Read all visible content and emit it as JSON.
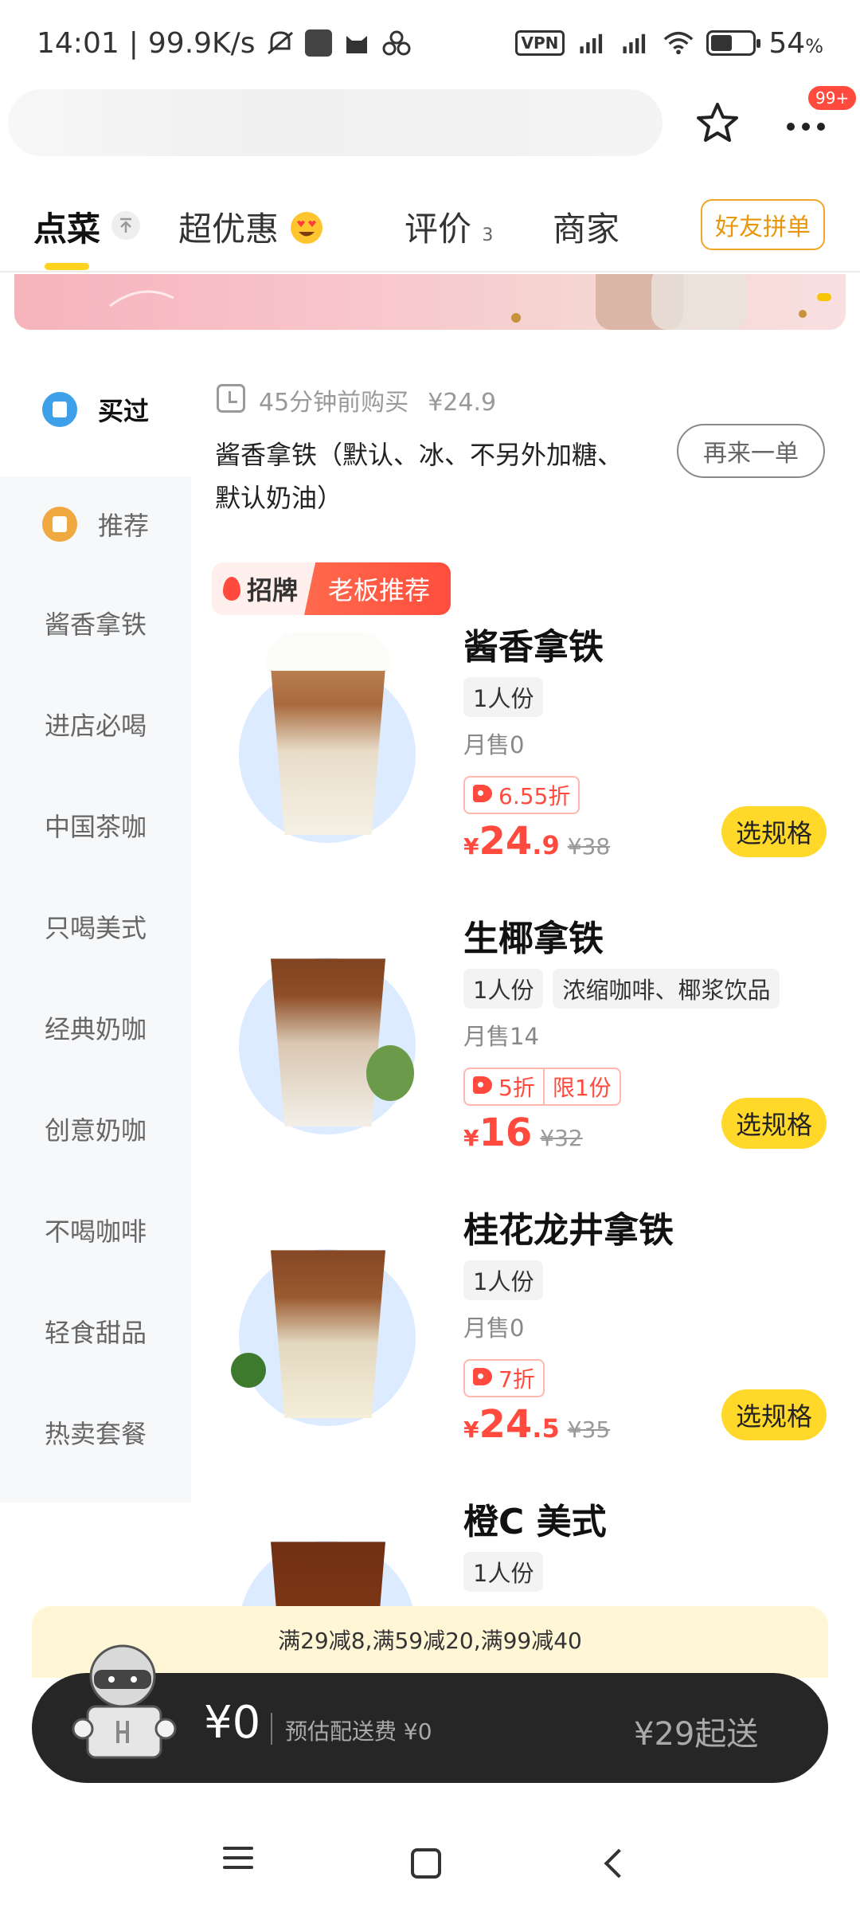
{
  "status_bar": {
    "time": "14:01",
    "net_speed": "99.9K/s",
    "vpn": "VPN",
    "battery": "54",
    "battery_unit": "%"
  },
  "header": {
    "more_badge": "99+"
  },
  "tabs": [
    {
      "label": "点菜"
    },
    {
      "label": "超优惠"
    },
    {
      "label": "评价",
      "count": "3"
    },
    {
      "label": "商家"
    }
  ],
  "friend_order": "好友拼单",
  "sidebar": {
    "items": [
      {
        "label": "买过"
      },
      {
        "label": "推荐"
      },
      {
        "label": "酱香拿铁"
      },
      {
        "label": "进店必喝"
      },
      {
        "label": "中国茶咖"
      },
      {
        "label": "只喝美式"
      },
      {
        "label": "经典奶咖"
      },
      {
        "label": "创意奶咖"
      },
      {
        "label": "不喝咖啡"
      },
      {
        "label": "轻食甜品"
      },
      {
        "label": "热卖套餐"
      }
    ]
  },
  "reorder": {
    "time_ago": "45分钟前购买",
    "price": "¥24.9",
    "item_name": "酱香拿铁（默认、冰、不另外加糖、默认奶油）",
    "button": "再来一单"
  },
  "signature": {
    "left": "招牌",
    "right": "老板推荐"
  },
  "products": [
    {
      "name": "酱香拿铁",
      "tags": [
        "1人份"
      ],
      "sales": "月售0",
      "discount": "6.55折",
      "limit": "",
      "currency": "¥",
      "price_int": "24",
      "price_dec": ".9",
      "orig_price": "¥38",
      "button": "选规格"
    },
    {
      "name": "生椰拿铁",
      "tags": [
        "1人份",
        "浓缩咖啡、椰浆饮品"
      ],
      "sales": "月售14",
      "discount": "5折",
      "limit": "限1份",
      "currency": "¥",
      "price_int": "16",
      "price_dec": "",
      "orig_price": "¥32",
      "button": "选规格"
    },
    {
      "name": "桂花龙井拿铁",
      "tags": [
        "1人份"
      ],
      "sales": "月售0",
      "discount": "7折",
      "limit": "",
      "currency": "¥",
      "price_int": "24",
      "price_dec": ".5",
      "orig_price": "¥35",
      "button": "选规格"
    },
    {
      "name": "橙C 美式",
      "tags": [
        "1人份"
      ]
    }
  ],
  "promo": "满29减8,满59减20,满99减40",
  "cart": {
    "total": "¥0",
    "delivery_fee": "预估配送费 ¥0",
    "min_order": "¥29起送"
  },
  "colors": {
    "accent_yellow": "#ffd82a",
    "price_red": "#ff4a3d",
    "friend_btn_orange": "#e8970a"
  }
}
